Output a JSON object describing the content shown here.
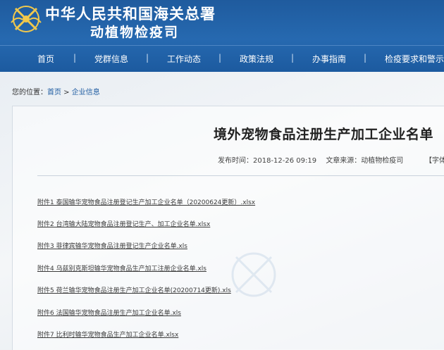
{
  "header": {
    "title_main": "中华人民共和国海关总署",
    "title_sub": "动植物检疫司",
    "bg_color": "#2166ac"
  },
  "nav": {
    "items": [
      "首页",
      "党群信息",
      "工作动态",
      "政策法规",
      "办事指南",
      "检疫要求和警示信"
    ],
    "separator": "|"
  },
  "breadcrumb": {
    "prefix": "您的位置：",
    "home": "首页",
    "arrow": " > ",
    "current": "企业信息"
  },
  "article": {
    "title": "境外宠物食品注册生产加工企业名单",
    "published": "发布时间：2018-12-26 09:19",
    "source": "文章来源：动植物检疫司",
    "font_ctrl": "【字体"
  },
  "attachments": [
    "附件1 泰国输华宠物食品注册登记生产加工企业名单（20200624更新）.xlsx",
    "附件2 台湾输大陆宠物食品注册登记生产、加工企业名单.xlsx",
    "附件3 菲律宾输华宠物食品注册登记生产企业名单.xls",
    "附件4 乌兹别克斯坦输华宠物食品生产加工注册企业名单.xls",
    "附件5 荷兰输华宠物食品注册生产加工企业名单(20200714更新).xls",
    "附件6 法国输华宠物食品注册生产加工企业名单.xls",
    "附件7 比利时输华宠物食品生产加工企业名单.xlsx"
  ]
}
